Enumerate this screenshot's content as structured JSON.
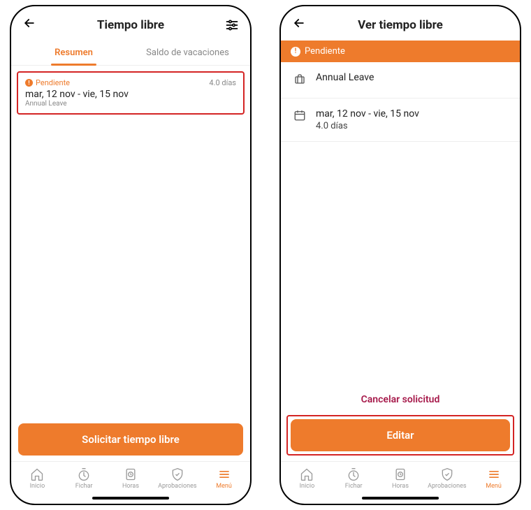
{
  "colors": {
    "accent": "#ee7b2c",
    "danger": "#a6194a",
    "highlight": "#d42424"
  },
  "left": {
    "header": {
      "title": "Tiempo libre"
    },
    "tabs": {
      "summary": "Resumen",
      "balance": "Saldo de vacaciones"
    },
    "card": {
      "status": "Pendiente",
      "days": "4.0 días",
      "date_range": "mar, 12 nov - vie, 15 nov",
      "leave_type": "Annual Leave"
    },
    "primary_btn": "Solicitar tiempo libre"
  },
  "right": {
    "header": {
      "title": "Ver tiempo libre"
    },
    "status_banner": "Pendiente",
    "leave_type": "Annual Leave",
    "date_range": "mar, 12 nov - vie, 15 nov",
    "days": "4.0 días",
    "cancel_label": "Cancelar solicitud",
    "primary_btn": "Editar"
  },
  "nav": {
    "home": "Inicio",
    "clock": "Fichar",
    "hours": "Horas",
    "approvals": "Aprobaciones",
    "menu": "Menú"
  }
}
